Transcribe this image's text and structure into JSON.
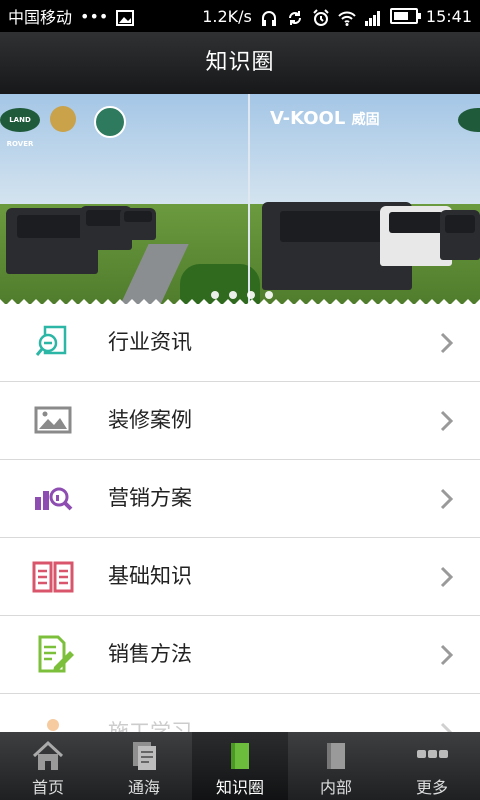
{
  "status_bar": {
    "carrier": "中国移动",
    "carrier_dots": "•••",
    "speed": "1.2K/s",
    "time": "15:41"
  },
  "header": {
    "title": "知识圈"
  },
  "banner": {
    "left_logo_text": "LAND ROVER",
    "right_logo_text": "V-KOOL",
    "right_logo_cn": "威固",
    "pages": 4,
    "active_page": 1
  },
  "list": {
    "items": [
      {
        "label": "行业资讯",
        "icon": "news-search-icon",
        "color": "#2bb6a5"
      },
      {
        "label": "装修案例",
        "icon": "image-icon",
        "color": "#8a8a8a"
      },
      {
        "label": "营销方案",
        "icon": "chart-search-icon",
        "color": "#8e4eb1"
      },
      {
        "label": "基础知识",
        "icon": "open-book-icon",
        "color": "#d8556b"
      },
      {
        "label": "销售方法",
        "icon": "edit-document-icon",
        "color": "#7cbf3b"
      },
      {
        "label": "施工学习",
        "icon": "learning-icon",
        "color": "#f0a860"
      }
    ]
  },
  "tabbar": {
    "tabs": [
      {
        "label": "首页",
        "icon": "home-icon"
      },
      {
        "label": "通海",
        "icon": "documents-icon"
      },
      {
        "label": "知识圈",
        "icon": "green-book-icon",
        "active": true
      },
      {
        "label": "内部",
        "icon": "folder-icon"
      },
      {
        "label": "更多",
        "icon": "more-dots-icon"
      }
    ]
  }
}
